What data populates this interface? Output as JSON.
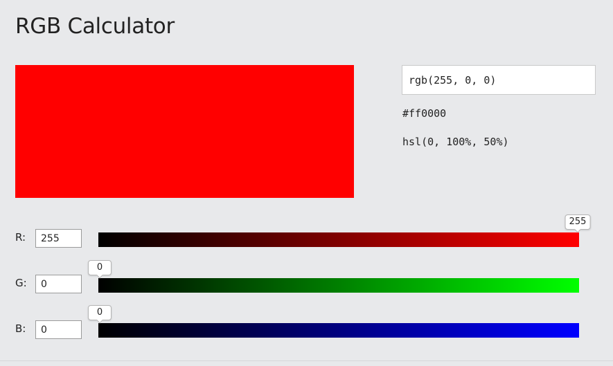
{
  "page": {
    "title": "RGB Calculator"
  },
  "color": {
    "preview_hex": "#ff0000",
    "rgb": "rgb(255, 0, 0)",
    "hex": "#ff0000",
    "hsl": "hsl(0, 100%, 50%)"
  },
  "channels": [
    {
      "label": "R:",
      "value": "255",
      "max": 255,
      "end_color": "#ff0000"
    },
    {
      "label": "G:",
      "value": "0",
      "max": 255,
      "end_color": "#00ff00"
    },
    {
      "label": "B:",
      "value": "0",
      "max": 255,
      "end_color": "#0000ff"
    }
  ]
}
